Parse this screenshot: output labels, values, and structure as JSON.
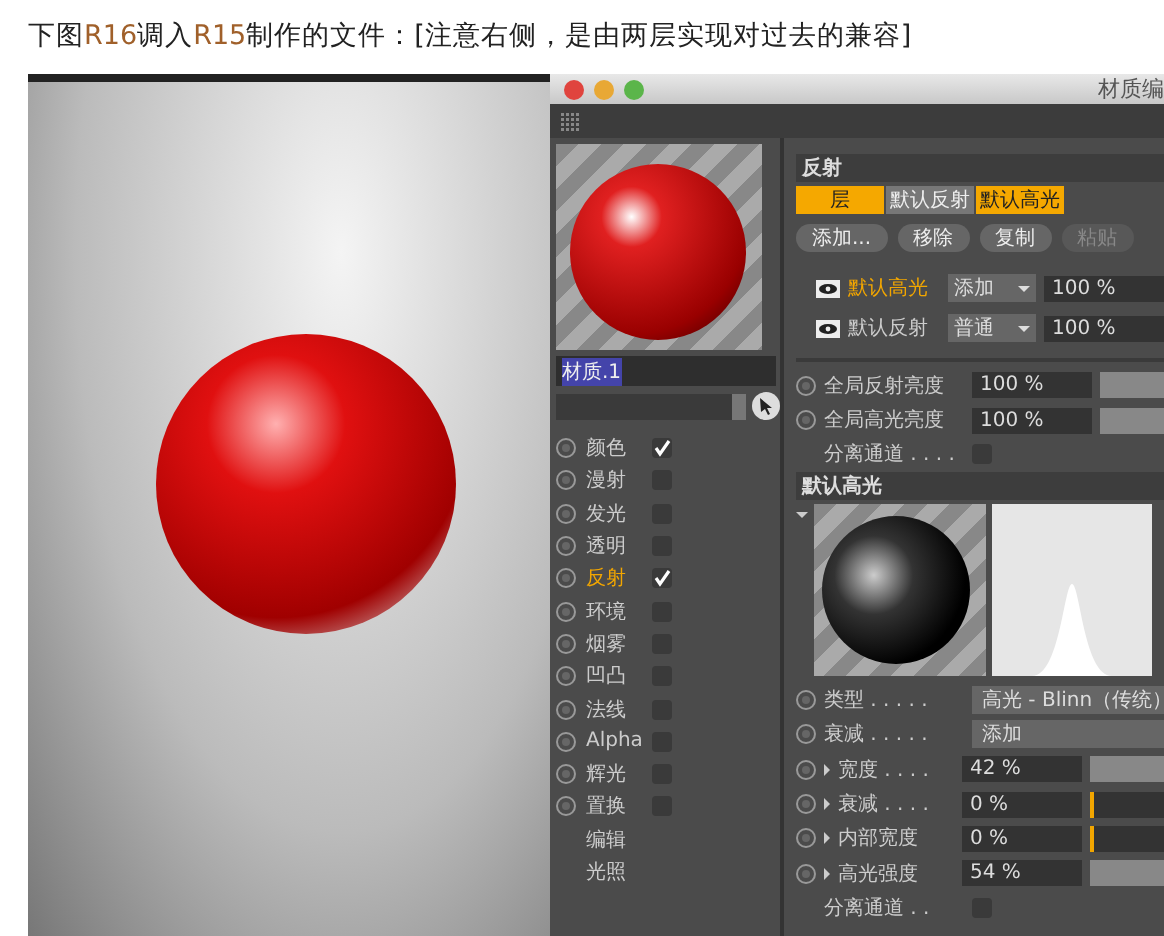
{
  "caption": [
    {
      "text": "下图",
      "kind": "plain"
    },
    {
      "text": "R16",
      "kind": "version"
    },
    {
      "text": "调入",
      "kind": "plain"
    },
    {
      "text": "R15",
      "kind": "version"
    },
    {
      "text": "制作的文件：[注意右侧，是由两层实现对过去的兼容]",
      "kind": "plain"
    }
  ],
  "window": {
    "title": "材质编"
  },
  "material": {
    "name": "材质.1"
  },
  "channels": [
    {
      "label": "颜色",
      "kind": "checkbox",
      "checked": true,
      "selected": false
    },
    {
      "label": "漫射",
      "kind": "checkbox",
      "checked": false,
      "selected": false
    },
    {
      "label": "发光",
      "kind": "checkbox",
      "checked": false,
      "selected": false
    },
    {
      "label": "透明",
      "kind": "checkbox",
      "checked": false,
      "selected": false
    },
    {
      "label": "反射",
      "kind": "checkbox",
      "checked": true,
      "selected": true
    },
    {
      "label": "环境",
      "kind": "checkbox",
      "checked": false,
      "selected": false
    },
    {
      "label": "烟雾",
      "kind": "checkbox",
      "checked": false,
      "selected": false
    },
    {
      "label": "凹凸",
      "kind": "checkbox",
      "checked": false,
      "selected": false
    },
    {
      "label": "法线",
      "kind": "checkbox",
      "checked": false,
      "selected": false
    },
    {
      "label": "Alpha",
      "kind": "checkbox",
      "checked": false,
      "selected": false
    },
    {
      "label": "辉光",
      "kind": "checkbox",
      "checked": false,
      "selected": false
    },
    {
      "label": "置换",
      "kind": "checkbox",
      "checked": false,
      "selected": false
    },
    {
      "label": "编辑",
      "kind": "plain",
      "selected": false
    },
    {
      "label": "光照",
      "kind": "plain",
      "selected": false
    }
  ],
  "section": {
    "title": "反射"
  },
  "layer_tabs": [
    {
      "label": "层",
      "selected": true
    },
    {
      "label": "默认反射",
      "selected": false
    },
    {
      "label": "默认高光",
      "selected": true
    }
  ],
  "buttons": [
    {
      "label": "添加...",
      "disabled": false
    },
    {
      "label": "移除",
      "disabled": false
    },
    {
      "label": "复制",
      "disabled": false
    },
    {
      "label": "粘贴",
      "disabled": true
    }
  ],
  "layers": [
    {
      "label": "默认高光",
      "selected": true,
      "mode": "添加",
      "value": "100 %"
    },
    {
      "label": "默认反射",
      "selected": false,
      "mode": "普通",
      "value": "100 %"
    }
  ],
  "globals": [
    {
      "kind": "slider",
      "label": "全局反射亮度",
      "value": "100 %",
      "level": 1
    },
    {
      "kind": "slider",
      "label": "全局高光亮度",
      "value": "100 %",
      "level": 1
    },
    {
      "kind": "checkbox",
      "label": "分离通道 . . . .",
      "checked": false
    }
  ],
  "layer_section": {
    "title": "默认高光"
  },
  "properties": [
    {
      "kind": "dropdown",
      "label": "类型 . . . . .",
      "value": "高光 - Blinn（传统）"
    },
    {
      "kind": "dropdown",
      "label": "衰减 . . . . .",
      "value": "添加"
    },
    {
      "kind": "slider",
      "label": "宽度 . . . .",
      "value": "42 %",
      "level": 0.42
    },
    {
      "kind": "slider",
      "label": "衰减 . . . .",
      "value": "0 %",
      "level": 0
    },
    {
      "kind": "slider",
      "label": "内部宽度",
      "value": "0 %",
      "level": 0
    },
    {
      "kind": "slider",
      "label": "高光强度",
      "value": "54 %",
      "level": 0.54
    },
    {
      "kind": "checkbox",
      "label": "分离通道 . .",
      "checked": false
    }
  ]
}
